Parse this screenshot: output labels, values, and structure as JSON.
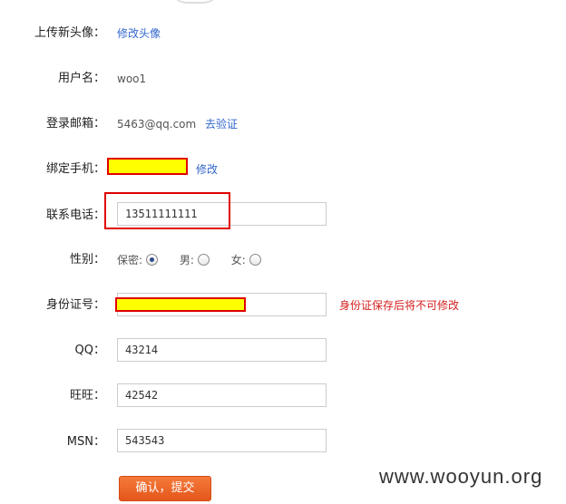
{
  "form": {
    "avatar": {
      "label": "上传新头像：",
      "link": "修改头像"
    },
    "username": {
      "label": "用户名：",
      "value": "woo1"
    },
    "email": {
      "label": "登录邮箱：",
      "value": "5463@qq.com",
      "link": "去验证"
    },
    "phone_bind": {
      "label": "绑定手机：",
      "link": "修改"
    },
    "contact_phone": {
      "label": "联系电话：",
      "value": "13511111111"
    },
    "gender": {
      "label": "性别：",
      "options": [
        {
          "label": "保密:",
          "checked": true
        },
        {
          "label": "男:",
          "checked": false
        },
        {
          "label": "女:",
          "checked": false
        }
      ]
    },
    "id_card": {
      "label": "身份证号：",
      "warning": "身份证保存后将不可修改"
    },
    "qq": {
      "label": "QQ：",
      "value": "43214"
    },
    "wangwang": {
      "label": "旺旺：",
      "value": "42542"
    },
    "msn": {
      "label": "MSN：",
      "value": "543543"
    },
    "submit_label": "确认，提交"
  },
  "watermark": "www.wooyun.org",
  "colors": {
    "link": "#3366cc",
    "warning": "#d42020",
    "button": "#e4561c",
    "redaction": "#ffff00",
    "highlight": "#e00000"
  }
}
